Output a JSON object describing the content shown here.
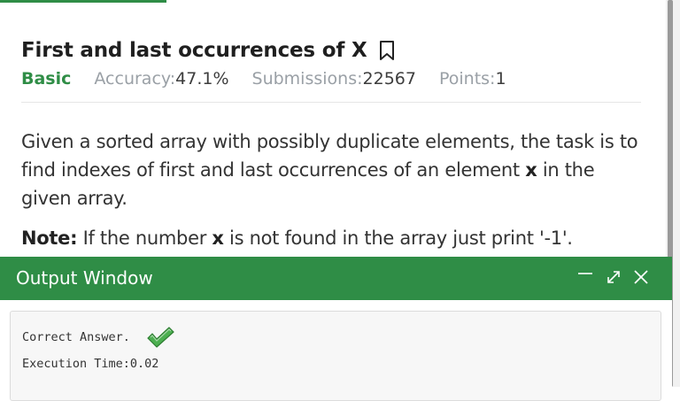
{
  "problem": {
    "title": "First and last occurrences of X",
    "difficulty": "Basic",
    "accuracy_label": "Accuracy:",
    "accuracy_value": "47.1%",
    "submissions_label": "Submissions:",
    "submissions_value": "22567",
    "points_label": "Points:",
    "points_value": "1",
    "desc_part1": "Given a sorted array with possibly duplicate elements, the task is to find indexes of first and last occurrences of an element ",
    "desc_x": "x",
    "desc_part2": " in the given array.",
    "note_label": "Note:",
    "note_part1": " If the number ",
    "note_x": "x",
    "note_part2": " is not found in the array just print '-1'."
  },
  "output_window": {
    "title": "Output Window",
    "minimize_icon": "minus-icon",
    "expand_icon": "expand-arrows-icon",
    "close_icon": "close-icon",
    "result_text": "Correct Answer.",
    "result_icon": "checkmark-icon",
    "time_text": "Execution Time:0.02"
  },
  "colors": {
    "accent": "#2f8d46",
    "title_text": "#1f1f1f",
    "meta_label": "#9aa0a6",
    "check": "#4caf50"
  }
}
